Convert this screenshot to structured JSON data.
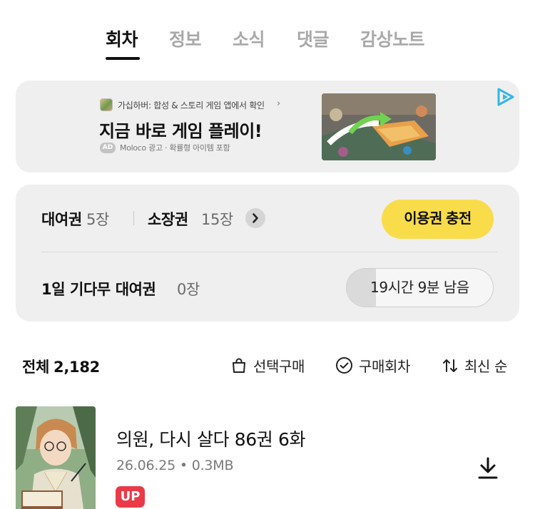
{
  "tabs": [
    {
      "label": "회차",
      "active": true
    },
    {
      "label": "정보",
      "active": false
    },
    {
      "label": "소식",
      "active": false
    },
    {
      "label": "댓글",
      "active": false
    },
    {
      "label": "감상노트",
      "active": false
    }
  ],
  "ad": {
    "source": "가십하버: 합성 & 스토리 게임 앱에서 확인",
    "source_chevron": "›",
    "title": "지금 바로 게임 플레이!",
    "badge": "AD",
    "disclaimer": "Moloco 광고 · 확률형 아이템 포함",
    "choices_icon": "adchoices-icon"
  },
  "tickets": {
    "rental_label": "대여권",
    "rental_count": "5장",
    "owned_label": "소장권",
    "owned_count": "15장",
    "more_icon": "chevron-right-icon",
    "charge_button": "이용권 충전",
    "wait_free_label": "1일 기다무 대여권",
    "wait_free_count": "0장",
    "timer_text": "19시간 9분 남음",
    "timer_progress": 0.2
  },
  "list_header": {
    "total_label": "전체",
    "total_count": "2,182",
    "select_buy": "선택구매",
    "purchased": "구매회차",
    "sort": "최신 순"
  },
  "episodes": [
    {
      "title": "의원, 다시 살다 86권 6화",
      "meta": "26.06.25 • 0.3MB",
      "badge": "UP",
      "action_icon": "download-icon"
    }
  ],
  "colors": {
    "accent_yellow": "#f9dc4a",
    "badge_red": "#ea3a48",
    "panel_bg": "#efefef",
    "inactive_tab": "#a9a9a9"
  }
}
